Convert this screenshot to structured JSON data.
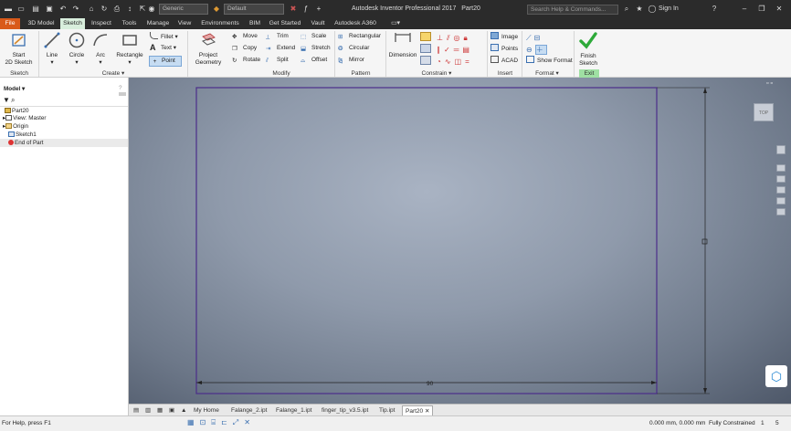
{
  "title_bar": {
    "app_title": "Autodesk Inventor Professional 2017",
    "doc_name": "Part20",
    "material": "Generic",
    "appearance": "Default",
    "search_placeholder": "Search Help & Commands...",
    "sign_in": "Sign In"
  },
  "tabs": [
    "File",
    "3D Model",
    "Sketch",
    "Inspect",
    "Tools",
    "Manage",
    "View",
    "Environments",
    "BIM",
    "Get Started",
    "Vault",
    "Autodesk A360"
  ],
  "active_tab": "Sketch",
  "ribbon": {
    "start_sketch": [
      "Start",
      "2D Sketch"
    ],
    "line": "Line",
    "circle": "Circle",
    "arc": "Arc",
    "rectangle": "Rectangle",
    "fillet": "Fillet",
    "text": "Text",
    "point": "Point",
    "project_geometry": [
      "Project",
      "Geometry"
    ],
    "move": "Move",
    "copy": "Copy",
    "rotate": "Rotate",
    "trim": "Trim",
    "extend": "Extend",
    "split": "Split",
    "scale": "Scale",
    "stretch": "Stretch",
    "offset": "Offset",
    "rectangular": "Rectangular",
    "circular": "Circular",
    "mirror": "Mirror",
    "dimension": "Dimension",
    "image": "Image",
    "points": "Points",
    "acad": "ACAD",
    "show_format": "Show Format",
    "finish_sketch": [
      "Finish",
      "Sketch"
    ],
    "groups": {
      "sketch": "Sketch",
      "create": "Create",
      "modify": "Modify",
      "pattern": "Pattern",
      "constrain": "Constrain",
      "insert": "Insert",
      "format": "Format",
      "exit": "Exit"
    }
  },
  "browser": {
    "header": "Model",
    "items": [
      "Part20",
      "View: Master",
      "Origin",
      "Sketch1",
      "End of Part"
    ]
  },
  "viewport": {
    "dimension_bottom": "90",
    "viewcube_label": "TOP"
  },
  "doc_tabs": [
    "My Home",
    "Falange_2.ipt",
    "Falange_1.ipt",
    "finger_tip_v3.5.ipt",
    "Tip.ipt",
    "Part20"
  ],
  "status": {
    "help": "For Help, press F1",
    "coords": "0.000 mm, 0.000 mm",
    "constraint": "Fully Constrained",
    "n1": "1",
    "n2": "5"
  },
  "colors": {
    "file_tab": "#d95a1a",
    "active_tab": "#d8eedc",
    "sketch_line": "#4b2d8a",
    "finish_green": "#2eaa3a"
  }
}
